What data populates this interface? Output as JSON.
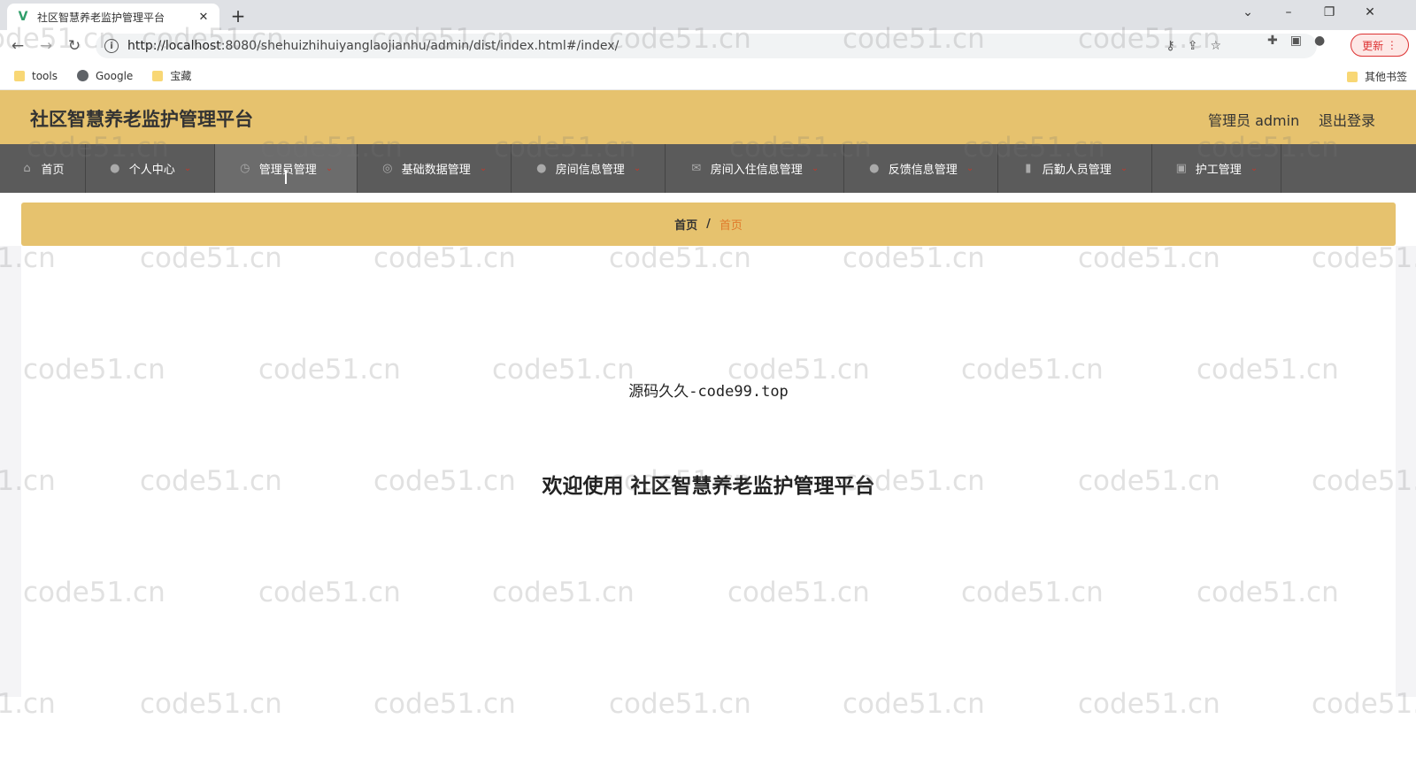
{
  "browser": {
    "tab_title": "社区智慧养老监护管理平台",
    "tab_close": "✕",
    "new_tab": "+",
    "url_host": "http://localhost",
    "url_rest": ":8080/shehuizhihuiyanglaojianhu/admin/dist/index.html#/index/",
    "update_label": "更新",
    "bookmarks": [
      {
        "label": "tools",
        "icon": "folder-icon"
      },
      {
        "label": "Google",
        "icon": "globe-icon"
      },
      {
        "label": "宝藏",
        "icon": "folder-icon"
      }
    ],
    "other_bookmarks": "其他书签"
  },
  "header": {
    "title": "社区智慧养老监护管理平台",
    "user": "管理员 admin",
    "logout": "退出登录"
  },
  "nav": {
    "items": [
      {
        "label": "首页",
        "icon": "home-icon"
      },
      {
        "label": "个人中心",
        "icon": "user-icon"
      },
      {
        "label": "管理员管理",
        "icon": "clock-icon"
      },
      {
        "label": "基础数据管理",
        "icon": "target-icon"
      },
      {
        "label": "房间信息管理",
        "icon": "person-icon"
      },
      {
        "label": "房间入住信息管理",
        "icon": "mail-icon"
      },
      {
        "label": "反馈信息管理",
        "icon": "drop-icon"
      },
      {
        "label": "后勤人员管理",
        "icon": "bar-chart-icon"
      },
      {
        "label": "护工管理",
        "icon": "clipboard-icon"
      }
    ]
  },
  "breadcrumb": {
    "home": "首页",
    "sep": "/",
    "current": "首页"
  },
  "content": {
    "source": "源码久久-code99.top",
    "welcome": "欢迎使用 社区智慧养老监护管理平台"
  },
  "watermark": "code51.cn",
  "colors": {
    "accent": "#e6c26e",
    "nav_bg": "#5b5b5b",
    "crumb_current": "#e07a2a"
  }
}
